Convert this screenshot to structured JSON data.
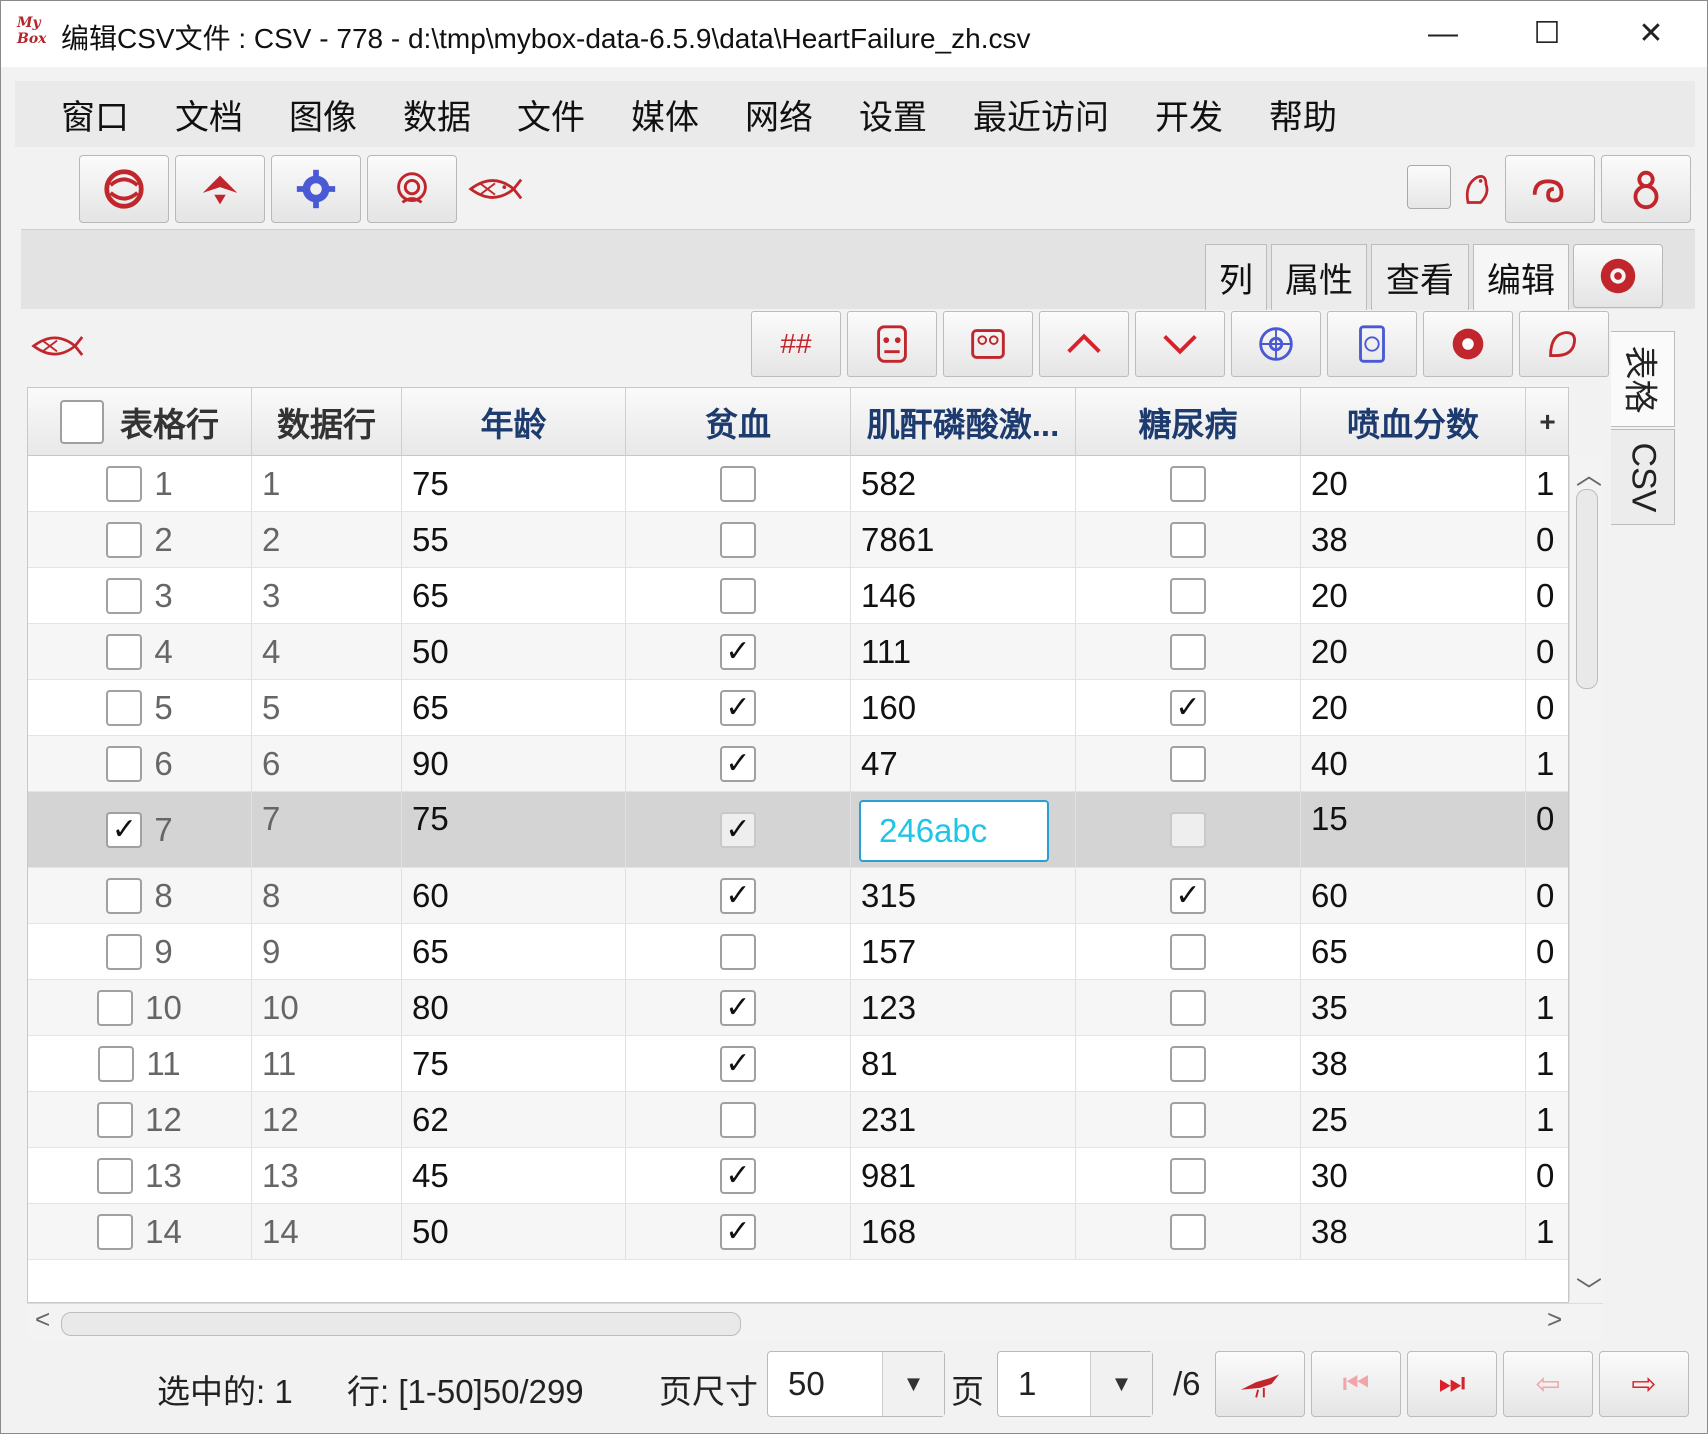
{
  "window": {
    "title": "编辑CSV文件 : CSV - 778 - d:\\tmp\\mybox-data-6.5.9\\data\\HeartFailure_zh.csv",
    "app_icon_text": "My Box",
    "minimize": "—",
    "maximize": "☐",
    "close": "✕"
  },
  "menu": [
    "窗口",
    "文档",
    "图像",
    "数据",
    "文件",
    "媒体",
    "网络",
    "设置",
    "最近访问",
    "开发",
    "帮助"
  ],
  "tabs": [
    "列",
    "属性",
    "查看",
    "编辑"
  ],
  "side_tabs": [
    "表格",
    "CSV"
  ],
  "toolbar2": {
    "hash_label": "##"
  },
  "table": {
    "headers": [
      "表格行",
      "数据行",
      "年龄",
      "贫血",
      "肌酐磷酸激...",
      "糖尿病",
      "喷血分数"
    ],
    "add_column": "+",
    "rows": [
      {
        "row": "1",
        "data": "1",
        "age": "75",
        "anemia": false,
        "cpk": "582",
        "diabetes": false,
        "ef": "20",
        "extra": "1",
        "sel": false
      },
      {
        "row": "2",
        "data": "2",
        "age": "55",
        "anemia": false,
        "cpk": "7861",
        "diabetes": false,
        "ef": "38",
        "extra": "0",
        "sel": false
      },
      {
        "row": "3",
        "data": "3",
        "age": "65",
        "anemia": false,
        "cpk": "146",
        "diabetes": false,
        "ef": "20",
        "extra": "0",
        "sel": false
      },
      {
        "row": "4",
        "data": "4",
        "age": "50",
        "anemia": true,
        "cpk": "111",
        "diabetes": false,
        "ef": "20",
        "extra": "0",
        "sel": false
      },
      {
        "row": "5",
        "data": "5",
        "age": "65",
        "anemia": true,
        "cpk": "160",
        "diabetes": true,
        "ef": "20",
        "extra": "0",
        "sel": false
      },
      {
        "row": "6",
        "data": "6",
        "age": "90",
        "anemia": true,
        "cpk": "47",
        "diabetes": false,
        "ef": "40",
        "extra": "1",
        "sel": false
      },
      {
        "row": "7",
        "data": "7",
        "age": "75",
        "anemia": true,
        "cpk": "246abc",
        "diabetes": false,
        "ef": "15",
        "extra": "0",
        "sel": true
      },
      {
        "row": "8",
        "data": "8",
        "age": "60",
        "anemia": true,
        "cpk": "315",
        "diabetes": true,
        "ef": "60",
        "extra": "0",
        "sel": false
      },
      {
        "row": "9",
        "data": "9",
        "age": "65",
        "anemia": false,
        "cpk": "157",
        "diabetes": false,
        "ef": "65",
        "extra": "0",
        "sel": false
      },
      {
        "row": "10",
        "data": "10",
        "age": "80",
        "anemia": true,
        "cpk": "123",
        "diabetes": false,
        "ef": "35",
        "extra": "1",
        "sel": false
      },
      {
        "row": "11",
        "data": "11",
        "age": "75",
        "anemia": true,
        "cpk": "81",
        "diabetes": false,
        "ef": "38",
        "extra": "1",
        "sel": false
      },
      {
        "row": "12",
        "data": "12",
        "age": "62",
        "anemia": false,
        "cpk": "231",
        "diabetes": false,
        "ef": "25",
        "extra": "1",
        "sel": false
      },
      {
        "row": "13",
        "data": "13",
        "age": "45",
        "anemia": true,
        "cpk": "981",
        "diabetes": false,
        "ef": "30",
        "extra": "0",
        "sel": false
      },
      {
        "row": "14",
        "data": "14",
        "age": "50",
        "anemia": true,
        "cpk": "168",
        "diabetes": false,
        "ef": "38",
        "extra": "1",
        "sel": false
      }
    ]
  },
  "status": {
    "selected": "选中的: 1",
    "rows": "行: [1-50]50/299",
    "page_size_label": "页尺寸",
    "page_size": "50",
    "page_label": "页",
    "page": "1",
    "page_total": "/6"
  },
  "colors": {
    "accent_red": "#c0262c",
    "header_text": "#1d3b6e",
    "editor_text": "#1ec5e6"
  }
}
